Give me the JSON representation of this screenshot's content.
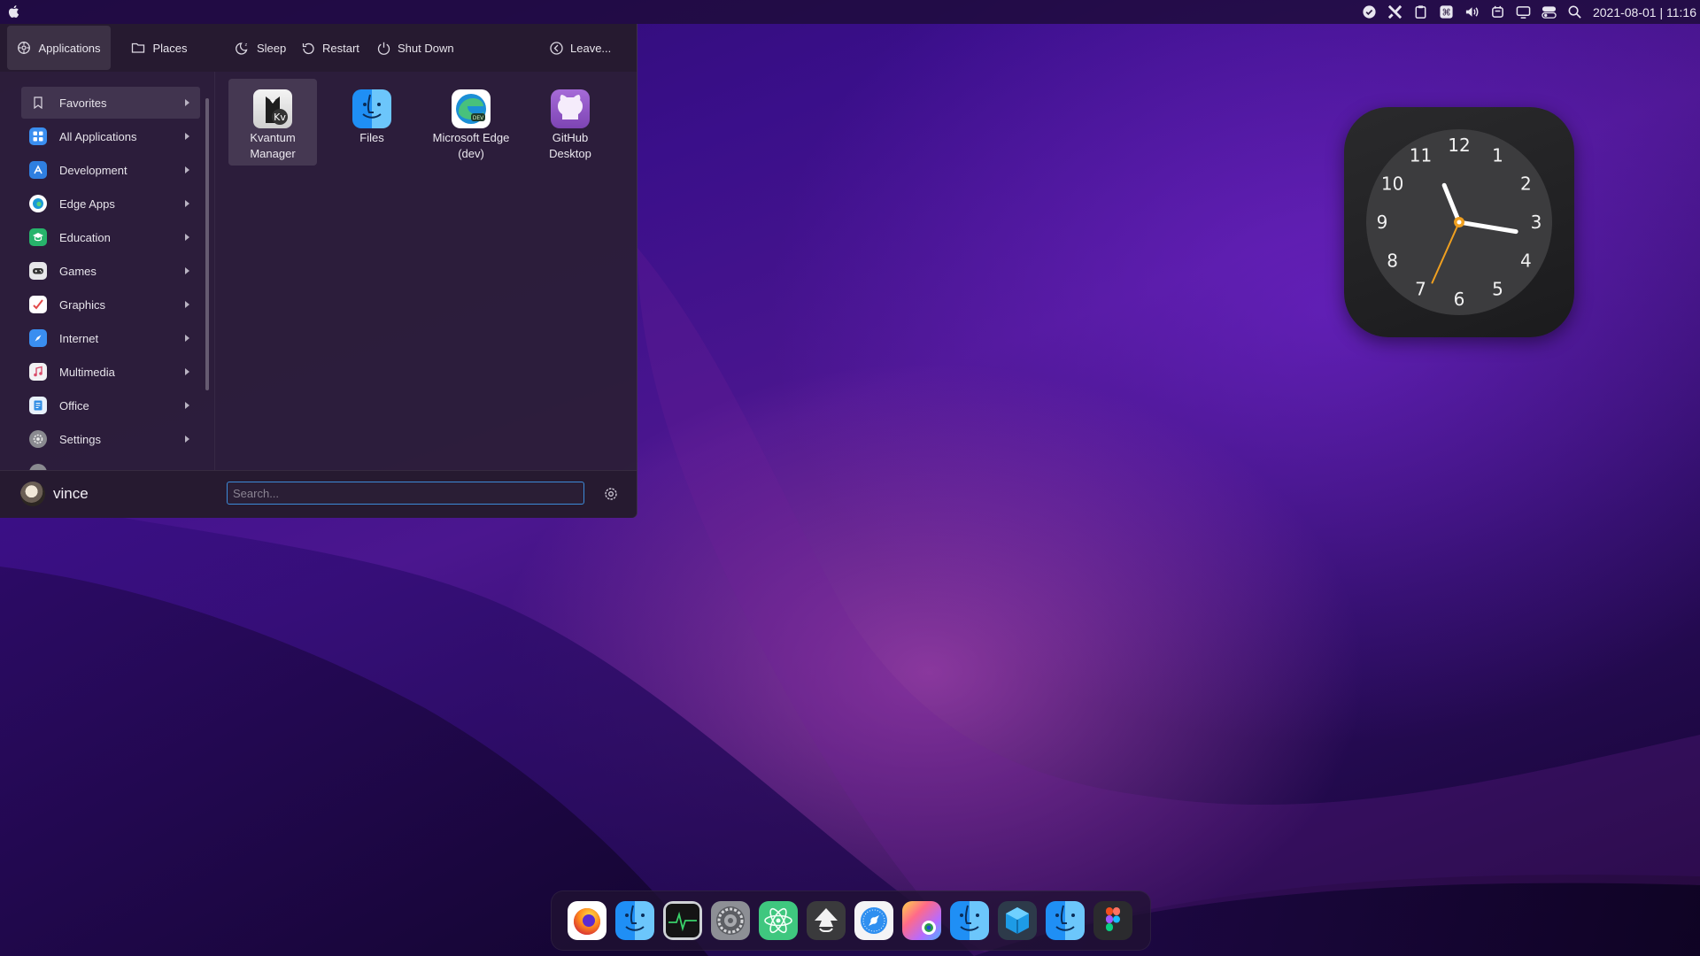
{
  "topbar": {
    "clock": "2021-08-01 | 11:16",
    "tray": [
      "check-circle-icon",
      "x-app-icon",
      "clipboard-icon",
      "command-icon",
      "volume-icon",
      "drive-icon",
      "display-icon",
      "toggle-icon",
      "search-icon"
    ]
  },
  "launcher": {
    "tabs": {
      "applications": "Applications",
      "places": "Places"
    },
    "power": {
      "sleep": "Sleep",
      "restart": "Restart",
      "shutdown": "Shut Down",
      "leave": "Leave..."
    },
    "categories": [
      {
        "label": "Favorites",
        "color": "#2c2236"
      },
      {
        "label": "All Applications",
        "color": "#3a8ef0"
      },
      {
        "label": "Development",
        "color": "#2f7fe0"
      },
      {
        "label": "Edge Apps",
        "color": "#1b9ad6"
      },
      {
        "label": "Education",
        "color": "#27b36b"
      },
      {
        "label": "Games",
        "color": "#3a3a40"
      },
      {
        "label": "Graphics",
        "color": "#e24a4a"
      },
      {
        "label": "Internet",
        "color": "#3a8ef0"
      },
      {
        "label": "Multimedia",
        "color": "#d94d6b"
      },
      {
        "label": "Office",
        "color": "#2f8de4"
      },
      {
        "label": "Settings",
        "color": "#8a8a90"
      }
    ],
    "apps": [
      {
        "label": "Kvantum Manager",
        "line1": "Kvantum",
        "line2": "Manager"
      },
      {
        "label": "Files",
        "line1": "Files",
        "line2": ""
      },
      {
        "label": "Microsoft Edge (dev)",
        "line1": "Microsoft Edge",
        "line2": "(dev)"
      },
      {
        "label": "GitHub Desktop",
        "line1": "GitHub",
        "line2": "Desktop"
      }
    ],
    "user": "vince",
    "search_placeholder": "Search..."
  },
  "clock_widget": {
    "numbers": [
      "12",
      "1",
      "2",
      "3",
      "4",
      "5",
      "6",
      "7",
      "8",
      "9",
      "10",
      "11"
    ],
    "hour": 11,
    "minute": 16,
    "second": 34
  },
  "dock": {
    "apps": [
      "firefox-icon",
      "finder-icon",
      "activity-monitor-icon",
      "system-preferences-icon",
      "atom-icon",
      "inkscape-icon",
      "safari-icon",
      "photos-icon",
      "finder-icon",
      "virtualbox-icon",
      "finder-icon",
      "figma-icon"
    ]
  }
}
